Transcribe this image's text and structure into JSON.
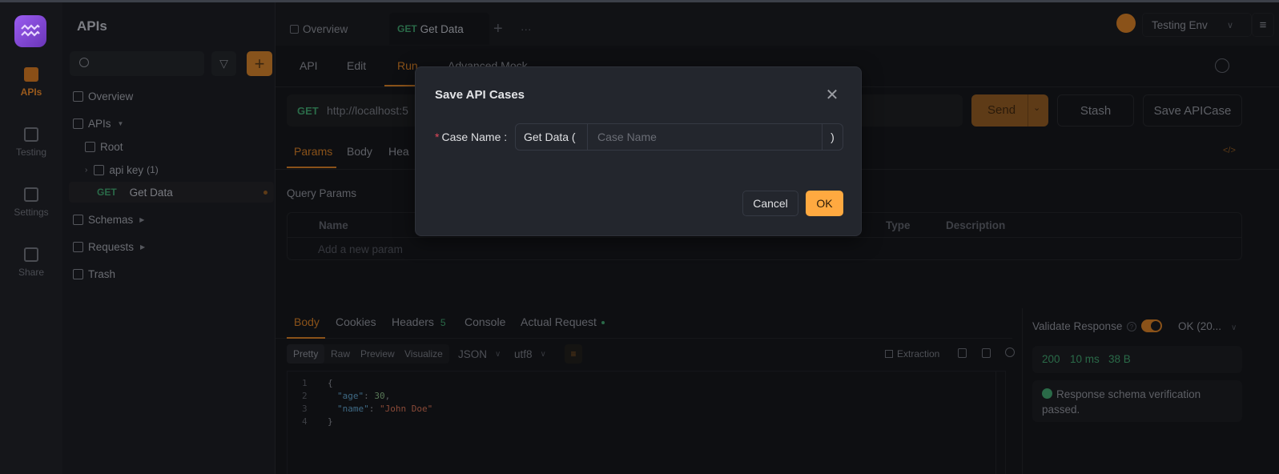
{
  "rail": {
    "items": [
      {
        "label": "APIs",
        "active": true
      },
      {
        "label": "Testing",
        "active": false
      },
      {
        "label": "Settings",
        "active": false
      },
      {
        "label": "Share",
        "active": false
      }
    ]
  },
  "sidebar": {
    "title": "APIs",
    "search_placeholder": "",
    "tree": {
      "overview": "Overview",
      "apis": "APIs",
      "root": "Root",
      "folder": "api key",
      "folder_count": "(1)",
      "endpoint_method": "GET",
      "endpoint_name": "Get Data",
      "schemas": "Schemas",
      "requests": "Requests",
      "trash": "Trash"
    }
  },
  "tabs": {
    "overview": "Overview",
    "active_method": "GET",
    "active_name": "Get Data",
    "add": "+",
    "more": "···"
  },
  "topright": {
    "env": "Testing Env"
  },
  "subtabs": [
    "API",
    "Edit",
    "Run",
    "Advanced Mock"
  ],
  "request": {
    "method": "GET",
    "url": "http://localhost:5",
    "send": "Send",
    "stash": "Stash",
    "save_case": "Save APICase"
  },
  "reqtabs": [
    "Params",
    "Body",
    "Hea"
  ],
  "params": {
    "section": "Query Params",
    "columns": [
      "Name",
      "Type",
      "Description"
    ],
    "placeholder": "Add a new param"
  },
  "response": {
    "tabs": [
      "Body",
      "Cookies",
      "Headers",
      "Console",
      "Actual Request"
    ],
    "headers_count": "5",
    "views": [
      "Pretty",
      "Raw",
      "Preview",
      "Visualize"
    ],
    "format": "JSON",
    "encoding": "utf8",
    "extraction": "Extraction",
    "code_lines": [
      "1",
      "2",
      "3",
      "4"
    ],
    "code": {
      "open": "{",
      "key1": "\"age\"",
      "val1": "30",
      "key2": "\"name\"",
      "val2": "\"John Doe\"",
      "close": "}"
    }
  },
  "validate": {
    "label": "Validate Response",
    "toggle_on": true,
    "status_select": "OK (20...",
    "status": "200",
    "time": "10 ms",
    "size": "38 B",
    "message": "Response schema verification passed."
  },
  "modal": {
    "title": "Save API Cases",
    "field_label": "Case Name :",
    "prefix": "Get Data  (",
    "input_value": "",
    "input_placeholder": "Case Name",
    "suffix": ")",
    "cancel": "Cancel",
    "ok": "OK"
  },
  "colors": {
    "accent": "#ffa940",
    "get_method": "#2a6a48",
    "required": "#e0475a"
  }
}
